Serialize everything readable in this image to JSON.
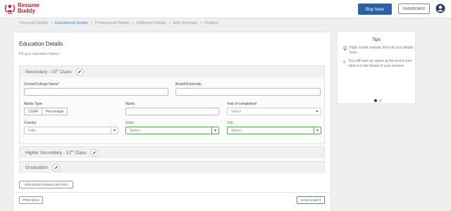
{
  "brand": {
    "line1": "Resume",
    "line2": "Buddy",
    "color": "#d11a26"
  },
  "header": {
    "buy_now": "Buy Now",
    "dashboard": "DASHBOARD",
    "account_icon": "account-circle-icon"
  },
  "breadcrumb": [
    {
      "label": "Personal Details",
      "active": false
    },
    {
      "label": "Educational Details",
      "active": true
    },
    {
      "label": "Professional Details",
      "active": false
    },
    {
      "label": "Additional Details",
      "active": false
    },
    {
      "label": "Add Summary",
      "active": false
    },
    {
      "label": "Finalise",
      "active": false
    }
  ],
  "main": {
    "title": "Education Details",
    "subtitle": "Fill your education history",
    "sections": {
      "secondary": {
        "title_prefix": "Secondary - 10",
        "title_sup": "th",
        "title_suffix": " Class"
      },
      "higher": {
        "title_prefix": "Higher Secondary - 12",
        "title_sup": "th",
        "title_suffix": " Class"
      },
      "graduation": {
        "title": "Graduation"
      }
    },
    "form": {
      "school_label": "School/College Name",
      "board_label": "Board/University",
      "marks_type_label": "Marks Type",
      "marks_type_options": [
        "CGPA",
        "Percentage"
      ],
      "marks_label": "Marks",
      "year_label": "Year of completion",
      "year_placeholder": "Select",
      "country_label": "Country",
      "country_value": "India",
      "state_label": "State",
      "state_placeholder": "Select...",
      "city_label": "City",
      "city_placeholder": "Select..."
    },
    "add_button": "ADD EDUCATIONAL DETAILS",
    "previous_button": "PREVIOUS",
    "save_button": "SAVE & NEXT"
  },
  "tips": {
    "title": "Tips",
    "items": [
      "High school onward, fill in all your details here.",
      "You will have an option at the end to pick what is to be shown in your resume."
    ],
    "carousel": {
      "pages": 2,
      "current": 1
    }
  },
  "colors": {
    "accent": "#2b5fa8",
    "required": "#d11a26",
    "valid": "#3a9a3a"
  }
}
